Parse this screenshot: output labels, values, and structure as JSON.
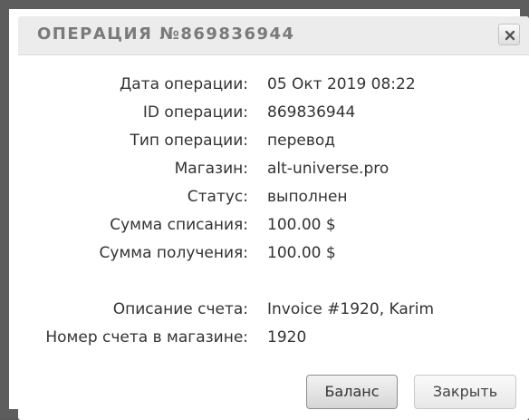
{
  "dialog": {
    "title": "ОПЕРАЦИЯ №869836944",
    "close_icon": "close-x-icon"
  },
  "details": [
    {
      "label": "Дата операции:",
      "value": "05 Окт 2019 08:22"
    },
    {
      "label": "ID операции:",
      "value": "869836944"
    },
    {
      "label": "Тип операции:",
      "value": "перевод"
    },
    {
      "label": "Магазин:",
      "value": "alt-universe.pro"
    },
    {
      "label": "Статус:",
      "value": "выполнен"
    },
    {
      "label": "Сумма списания:",
      "value": "100.00 $"
    },
    {
      "label": "Сумма получения:",
      "value": "100.00 $"
    }
  ],
  "invoice_details": [
    {
      "label": "Описание счета:",
      "value": "Invoice #1920, Karim"
    },
    {
      "label": "Номер счета в магазине:",
      "value": "1920"
    }
  ],
  "buttons": {
    "balance_label": "Баланс",
    "close_label": "Закрыть"
  }
}
